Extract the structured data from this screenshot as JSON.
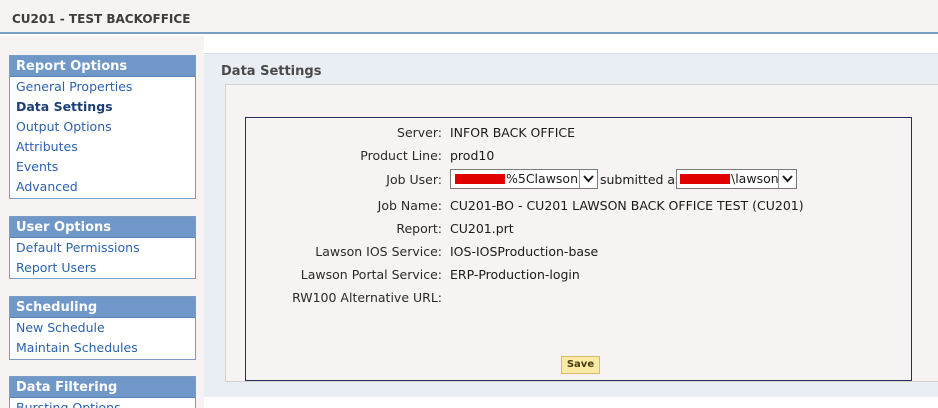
{
  "app": {
    "title": "CU201 - TEST BACKOFFICE"
  },
  "nav": {
    "report_options": {
      "header": "Report Options",
      "items": [
        "General Properties",
        "Data Settings",
        "Output Options",
        "Attributes",
        "Events",
        "Advanced"
      ],
      "active": "Data Settings"
    },
    "user_options": {
      "header": "User Options",
      "items": [
        "Default Permissions",
        "Report Users"
      ]
    },
    "scheduling": {
      "header": "Scheduling",
      "items": [
        "New Schedule",
        "Maintain Schedules"
      ]
    },
    "data_filtering": {
      "header": "Data Filtering",
      "items": [
        "Bursting Options"
      ]
    }
  },
  "main": {
    "section_title": "Data Settings",
    "fields": {
      "server": {
        "label": "Server:",
        "value": "INFOR BACK OFFICE"
      },
      "product_line": {
        "label": "Product Line:",
        "value": "prod10"
      },
      "job_user": {
        "label": "Job User:",
        "user_select_value": "%5Clawson",
        "submitted_as_text": "submitted as",
        "submit_select_value": "\\lawson"
      },
      "job_name": {
        "label": "Job Name:",
        "value": "CU201-BO - CU201 LAWSON BACK OFFICE TEST (CU201)"
      },
      "report": {
        "label": "Report:",
        "value": "CU201.prt"
      },
      "lawson_ios_service": {
        "label": "Lawson IOS Service:",
        "value": "IOS-IOSProduction-base"
      },
      "lawson_portal_service": {
        "label": "Lawson Portal Service:",
        "value": "ERP-Production-login"
      },
      "rw100_alt_url": {
        "label": "RW100 Alternative URL:",
        "value": ""
      }
    },
    "save_label": "Save"
  },
  "colors": {
    "header_border": "#7a9dc6",
    "nav_header_bg": "#6f97c8",
    "nav_link": "#2a62b0",
    "redaction": "#e00000",
    "save_button_bg": "#fbeaa5"
  },
  "icons": {
    "select_arrow": "chevron-down-icon"
  }
}
